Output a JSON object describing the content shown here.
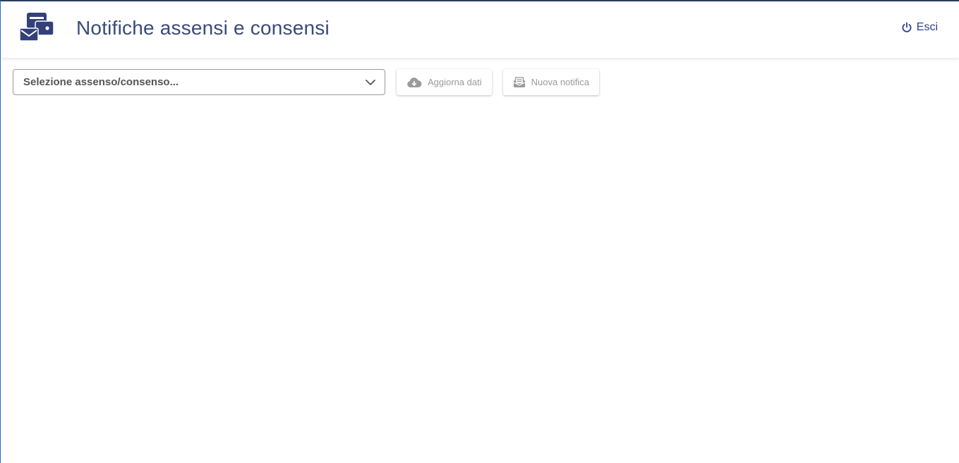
{
  "header": {
    "title": "Notifiche assensi e consensi",
    "logout_label": "Esci",
    "logo_icon": "mail-wallet-icon",
    "logout_icon": "power-icon"
  },
  "toolbar": {
    "select": {
      "value": "Selezione assenso/consenso...",
      "icon": "chevron-down-icon"
    },
    "refresh_button": {
      "label": "Aggiorna dati",
      "icon": "cloud-download-icon",
      "disabled": true
    },
    "new_notification_button": {
      "label": "Nuova notifica",
      "icon": "mail-open-icon",
      "disabled": true
    }
  },
  "colors": {
    "primary": "#2f3f8f",
    "title": "#3a4a7a",
    "disabled": "#9a9a9a",
    "frame_accent": "#1e6fd0"
  }
}
